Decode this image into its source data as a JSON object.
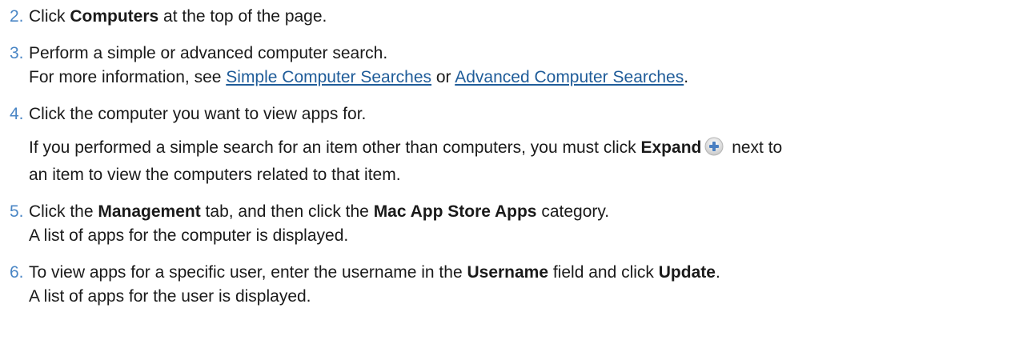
{
  "steps": [
    {
      "num": "2.",
      "pre": "Click ",
      "bold": "Computers",
      "post": " at the top of the page."
    },
    {
      "num": "3.",
      "line1": "Perform a simple or advanced computer search.",
      "line2_pre": "For more information, see ",
      "link1": "Simple Computer Searches",
      "line2_mid": " or ",
      "link2": "Advanced Computer Searches",
      "line2_post": "."
    },
    {
      "num": "4.",
      "line1": "Click the computer you want to view apps for.",
      "para_pre": "If you performed a simple search for an item other than computers, you must click ",
      "para_bold": "Expand",
      "para_post1": " next to",
      "para_post2": "an item to view the computers related to that item.",
      "icon": "plus-circle-icon"
    },
    {
      "num": "5.",
      "pre": "Click the ",
      "bold1": "Management",
      "mid": " tab, and then click the ",
      "bold2": "Mac App Store Apps",
      "post": " category.",
      "line2": "A list of apps for the computer is displayed."
    },
    {
      "num": "6.",
      "pre": "To view apps for a specific user, enter the username in the ",
      "bold1": "Username",
      "mid": " field and click ",
      "bold2": "Update",
      "post": ".",
      "line2": "A list of apps for the user is displayed."
    }
  ],
  "colors": {
    "number": "#4a86c5",
    "link": "#1f5c99",
    "text": "#1a1a1a"
  }
}
